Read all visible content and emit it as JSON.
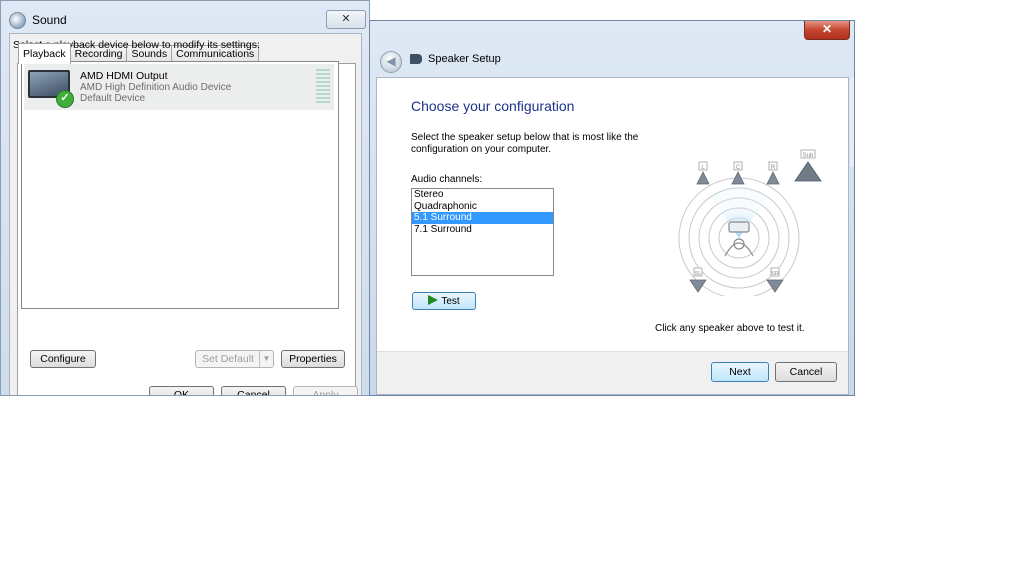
{
  "sound": {
    "title": "Sound",
    "close_glyph": "✕",
    "tabs": [
      "Playback",
      "Recording",
      "Sounds",
      "Communications"
    ],
    "instruction": "Select a playback device below to modify its settings:",
    "device": {
      "name": "AMD HDMI Output",
      "driver": "AMD High Definition Audio Device",
      "state": "Default Device"
    },
    "buttons": {
      "configure": "Configure",
      "set_default": "Set Default",
      "properties": "Properties",
      "ok": "OK",
      "cancel": "Cancel",
      "apply": "Apply"
    }
  },
  "speaker_setup": {
    "title": "Speaker Setup",
    "close_glyph": "✕",
    "heading": "Choose your configuration",
    "description": "Select the speaker setup below that is most like the configuration on your computer.",
    "channels_label": "Audio channels:",
    "channels": [
      "Stereo",
      "Quadraphonic",
      "5.1 Surround",
      "7.1 Surround"
    ],
    "selected_channel": "5.1 Surround",
    "test_label": "Test",
    "speakers": [
      "L",
      "C",
      "R",
      "Sub",
      "SL",
      "SR"
    ],
    "hint": "Click any speaker above to test it.",
    "next_label": "Next",
    "cancel_label": "Cancel"
  },
  "colors": {
    "heading": "#1e3287",
    "selection": "#3399ff",
    "close_red": "#c6452f"
  }
}
